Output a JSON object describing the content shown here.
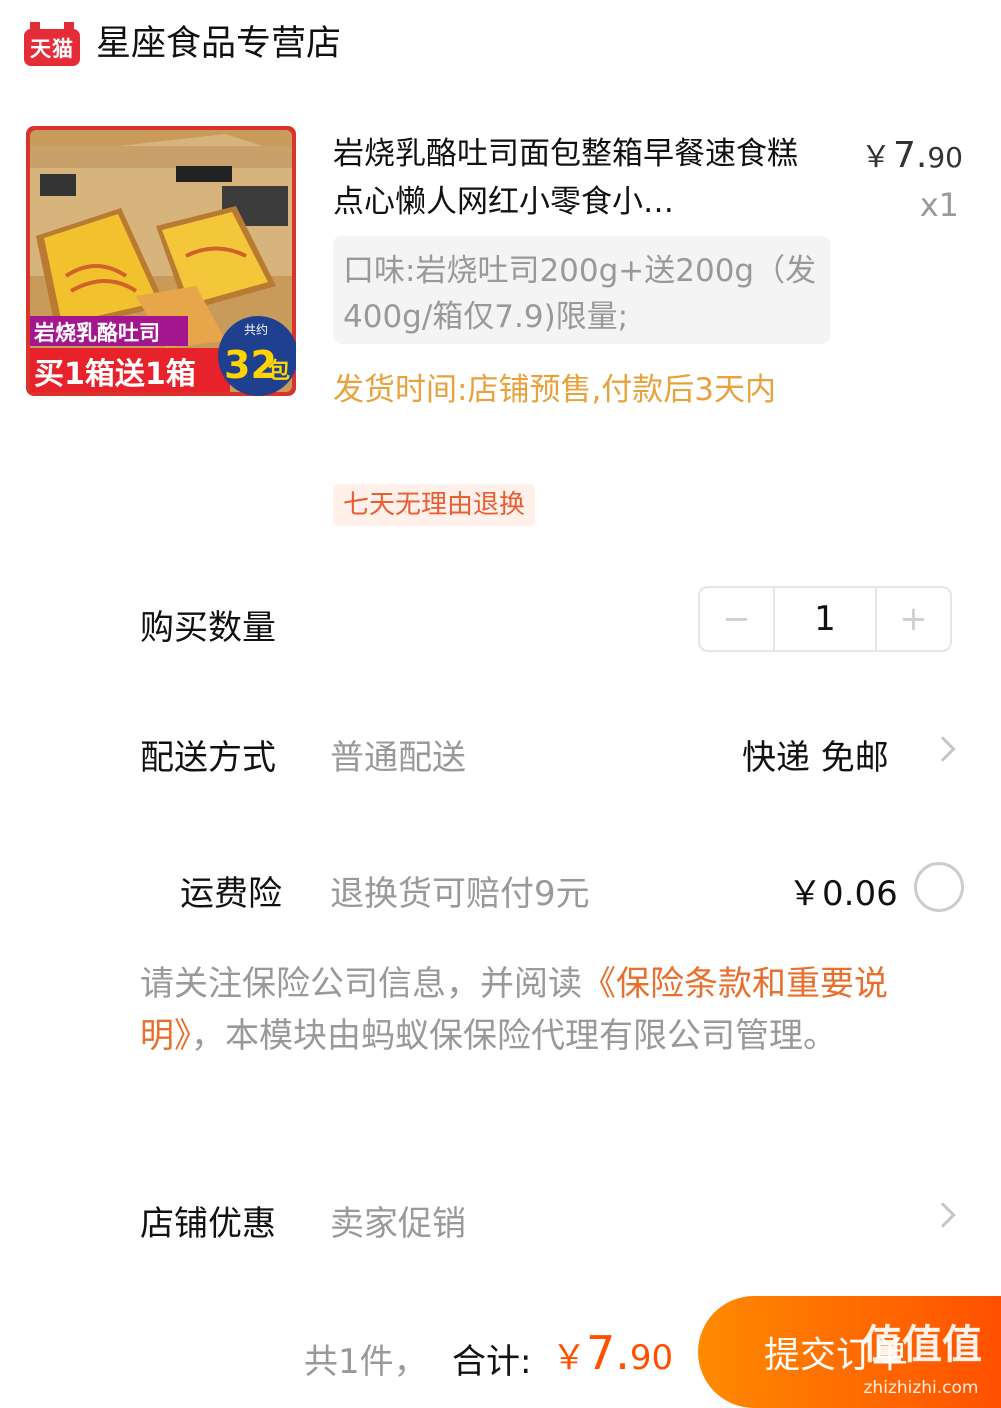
{
  "store": {
    "logo_text": "天猫",
    "name": "星座食品专营店"
  },
  "product": {
    "title": "岩烧乳酪吐司面包整箱早餐速食糕点心懒人网红小零食小…",
    "price_yen": "￥",
    "price_int": "7.",
    "price_dec": "90",
    "quantity_badge": "x1",
    "spec": "口味:岩烧吐司200g+送200g（发400g/箱仅7.9)限量;",
    "ship_time": "发货时间:店铺预售,付款后3天内",
    "return_tag": "七天无理由退换",
    "image_texts": {
      "banner": "岩烧乳酪吐司",
      "promo": "买1箱送1箱",
      "about": "共约",
      "count": "32",
      "unit": "包"
    }
  },
  "quantity": {
    "label": "购买数量",
    "minus": "−",
    "value": "1",
    "plus": "+"
  },
  "delivery": {
    "label": "配送方式",
    "method": "普通配送",
    "value": "快递 免邮"
  },
  "insurance": {
    "label": "运费险",
    "desc": "退换货可赔付9元",
    "price": "￥0.06",
    "note_pre": "请关注保险公司信息，并阅读",
    "note_link": "《保险条款和重要说明》",
    "note_post": "，本模块由蚂蚁保保险代理有限公司管理。"
  },
  "promo": {
    "label": "店铺优惠",
    "value": "卖家促销"
  },
  "footer": {
    "count_text": "共1件，",
    "total_label": "合计:",
    "total_yen": "￥",
    "total_int": "7.",
    "total_dec": "90",
    "submit": "提交订单",
    "watermark": "值值值",
    "watermark_site": "zhizhizhi.com"
  },
  "colors": {
    "tmall_red": "#e52d3a",
    "accent_orange": "#ff5000",
    "ship_time_gold": "#e8a23c",
    "link_orange": "#e86f2c"
  }
}
